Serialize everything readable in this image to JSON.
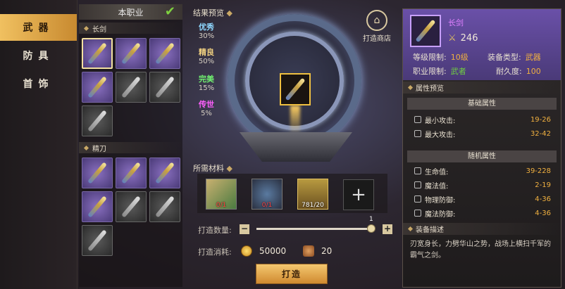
{
  "categories": [
    {
      "label": "武器",
      "active": true
    },
    {
      "label": "防具",
      "active": false
    },
    {
      "label": "首饰",
      "active": false
    }
  ],
  "job_header": "本职业",
  "sections": {
    "sword": "长剑",
    "blade": "精刀"
  },
  "sword_items": [
    "purple",
    "purple",
    "purple",
    "purple",
    "grey",
    "grey",
    "grey"
  ],
  "blade_items": [
    "purple",
    "purple",
    "purple",
    "purple",
    "grey",
    "grey",
    "grey"
  ],
  "preview": {
    "title": "结果预览",
    "qualities": [
      {
        "name": "优秀",
        "pct": "30%",
        "color": "#8fd8ff"
      },
      {
        "name": "精良",
        "pct": "50%",
        "color": "#f0d080"
      },
      {
        "name": "完美",
        "pct": "15%",
        "color": "#70f070"
      },
      {
        "name": "传世",
        "pct": "5%",
        "color": "#ff60ff"
      }
    ]
  },
  "shop": {
    "label": "打造商店"
  },
  "materials": {
    "title": "所需材料",
    "items": [
      {
        "count": "0/1",
        "enough": false
      },
      {
        "count": "0/1",
        "enough": false
      },
      {
        "count": "781/20",
        "enough": true
      }
    ]
  },
  "quantity": {
    "label": "打造数量:",
    "value": "1"
  },
  "cost": {
    "label": "打造消耗:",
    "gold": "50000",
    "token": "20"
  },
  "craft_button": "打造",
  "info": {
    "name": "长剑",
    "power": "246",
    "level_label": "等级限制:",
    "level_value": "10级",
    "type_label": "装备类型:",
    "type_value": "武器",
    "job_label": "职业限制:",
    "job_value": "武者",
    "dura_label": "耐久度:",
    "dura_value": "100",
    "attr_preview": "属性预览",
    "basic_title": "基础属性",
    "basic": [
      {
        "name": "最小攻击:",
        "value": "19-26"
      },
      {
        "name": "最大攻击:",
        "value": "32-42"
      }
    ],
    "random_title": "随机属性",
    "random": [
      {
        "name": "生命值:",
        "value": "39-228"
      },
      {
        "name": "魔法值:",
        "value": "2-19"
      },
      {
        "name": "物理防御:",
        "value": "4-36"
      },
      {
        "name": "魔法防御:",
        "value": "4-36"
      }
    ],
    "desc_title": "装备描述",
    "desc": "刃宽身长，力劈华山之势，战场上横扫千军的霸气之剑。"
  },
  "colors": {
    "accent": "#f0c060",
    "stat_value": "#f0b040",
    "green": "#70d040"
  }
}
